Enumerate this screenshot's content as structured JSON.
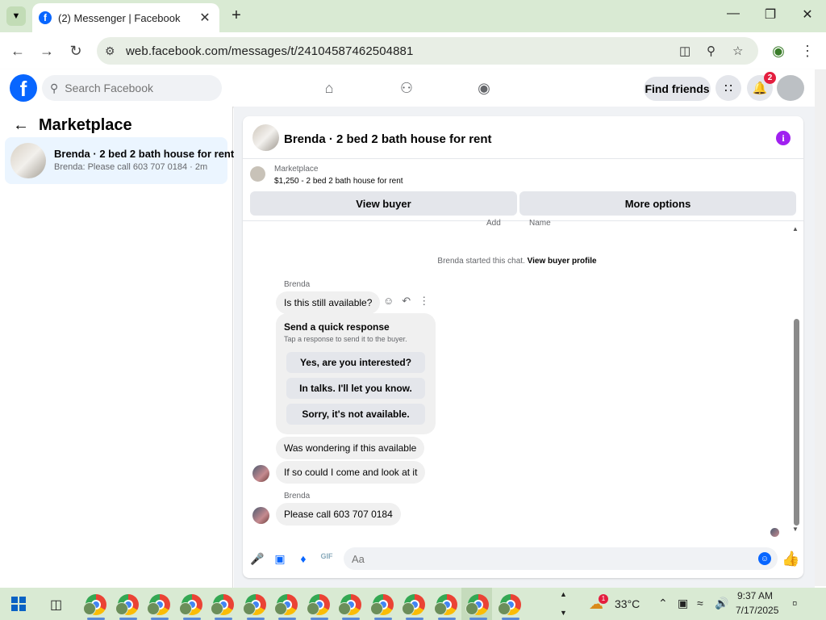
{
  "browser": {
    "tab_title": "(2) Messenger | Facebook",
    "tab_favicon": "f",
    "url": "web.facebook.com/messages/t/24104587462504881"
  },
  "facebook": {
    "search_placeholder": "Search Facebook",
    "find_friends": "Find friends",
    "notification_count": "2",
    "brand_color": "#0866ff"
  },
  "sidebar": {
    "title": "Marketplace",
    "conversation": {
      "title": "Brenda · 2 bed 2 bath house for rent",
      "snippet": "Brenda: Please call 603 707 0184 · 2m"
    }
  },
  "chat": {
    "header_title": "Brenda · 2 bed 2 bath house for rent",
    "listing_source": "Marketplace",
    "listing_detail": "$1,250 - 2 bed 2 bath house for rent",
    "view_buyer_button": "View buyer",
    "more_options_button": "More options",
    "cut_labels": [
      "Add",
      "Name"
    ],
    "system_text": "Brenda started this chat.",
    "system_link": "View buyer profile",
    "sender_1": "Brenda",
    "msg_1": "Is this still available?",
    "quick_response": {
      "heading": "Send a quick response",
      "subtitle": "Tap a response to send it to the buyer.",
      "options": [
        "Yes, are you interested?",
        "In talks. I'll let you know.",
        "Sorry, it's not available."
      ]
    },
    "msg_2": "Was wondering if this available",
    "msg_3": "If so could I come and look at it",
    "sender_2": "Brenda",
    "msg_4": "Please call 603 707 0184",
    "composer_placeholder": "Aa"
  },
  "taskbar": {
    "weather_alert": "1",
    "temperature": "33°C",
    "time": "9:37 AM",
    "date": "7/17/2025",
    "app_count": 14
  }
}
